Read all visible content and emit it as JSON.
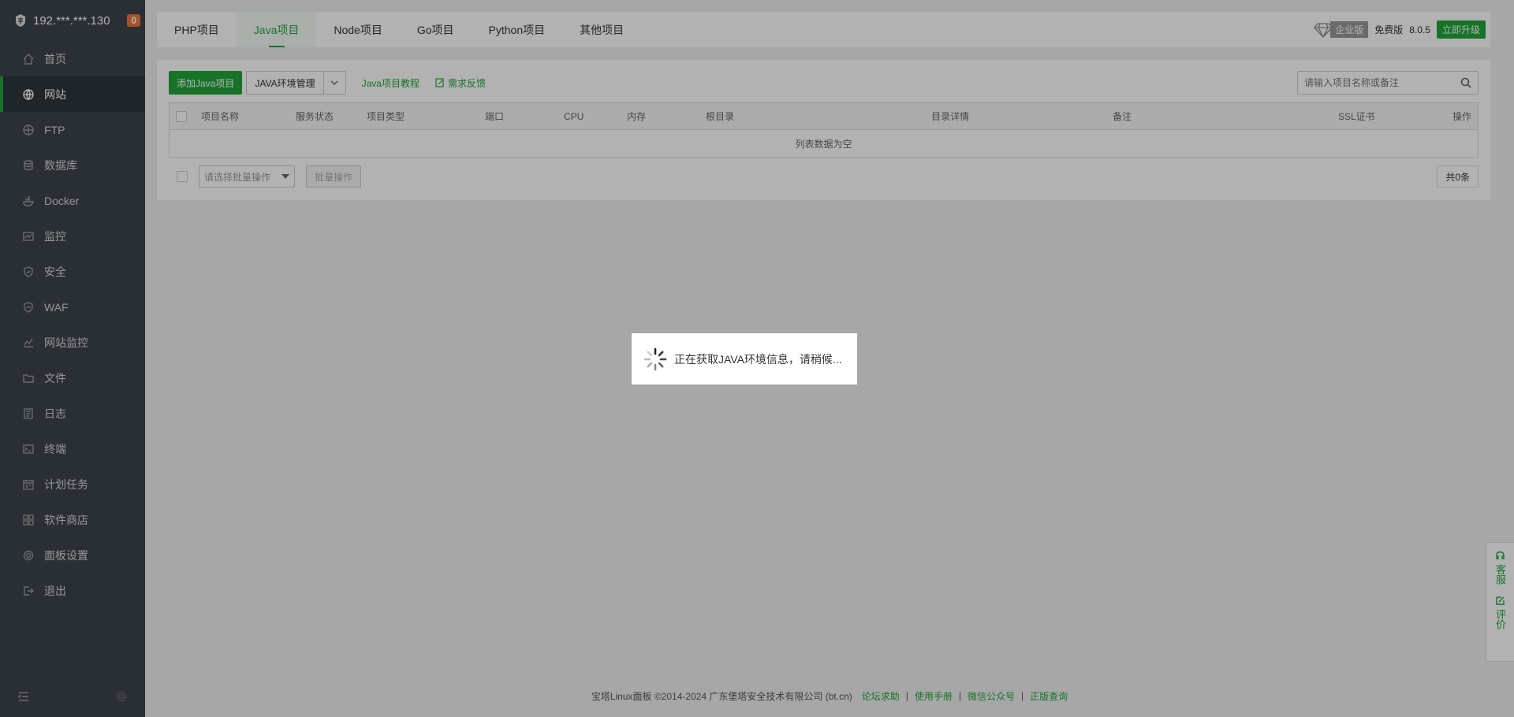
{
  "sidebar": {
    "server_ip": "192.***.***.130",
    "badge_count": "0",
    "items": [
      {
        "label": "首页",
        "icon": "home-icon"
      },
      {
        "label": "网站",
        "icon": "globe-icon"
      },
      {
        "label": "FTP",
        "icon": "ftp-icon"
      },
      {
        "label": "数据库",
        "icon": "database-icon"
      },
      {
        "label": "Docker",
        "icon": "docker-icon"
      },
      {
        "label": "监控",
        "icon": "monitor-icon"
      },
      {
        "label": "安全",
        "icon": "shield-icon"
      },
      {
        "label": "WAF",
        "icon": "waf-icon"
      },
      {
        "label": "网站监控",
        "icon": "chart-icon"
      },
      {
        "label": "文件",
        "icon": "folder-icon"
      },
      {
        "label": "日志",
        "icon": "log-icon"
      },
      {
        "label": "终端",
        "icon": "terminal-icon"
      },
      {
        "label": "计划任务",
        "icon": "calendar-icon"
      },
      {
        "label": "软件商店",
        "icon": "apps-icon"
      },
      {
        "label": "面板设置",
        "icon": "gear-icon"
      },
      {
        "label": "退出",
        "icon": "logout-icon"
      }
    ]
  },
  "tabs": [
    {
      "label": "PHP项目"
    },
    {
      "label": "Java项目"
    },
    {
      "label": "Node项目"
    },
    {
      "label": "Go项目"
    },
    {
      "label": "Python项目"
    },
    {
      "label": "其他项目"
    }
  ],
  "header_right": {
    "enterprise_label": "企业版",
    "free_label": "免费版",
    "version": "8.0.5",
    "upgrade_label": "立即升级"
  },
  "toolbar": {
    "add_button": "添加Java项目",
    "env_manage": "JAVA环境管理",
    "tutorial_link": "Java项目教程",
    "feedback_link": "需求反馈",
    "search_placeholder": "请输入项目名称或备注"
  },
  "table": {
    "columns": [
      "项目名称",
      "服务状态",
      "项目类型",
      "端口",
      "CPU",
      "内存",
      "根目录",
      "目录详情",
      "备注",
      "SSL证书",
      "操作"
    ],
    "empty_text": "列表数据为空"
  },
  "batch": {
    "select_placeholder": "请选择批量操作",
    "button": "批量操作",
    "total": "共0条"
  },
  "footer": {
    "copyright": "宝塔Linux面板 ©2014-2024 广东堡塔安全技术有限公司 (bt.cn)",
    "links": [
      "论坛求助",
      "使用手册",
      "微信公众号",
      "正版查询"
    ]
  },
  "helper": {
    "service": "客服",
    "review": "评价"
  },
  "loading": {
    "message": "正在获取JAVA环境信息，请稍候..."
  },
  "colors": {
    "accent": "#20a53a",
    "sidebar_bg": "#3c444d",
    "badge": "#f0743c"
  }
}
